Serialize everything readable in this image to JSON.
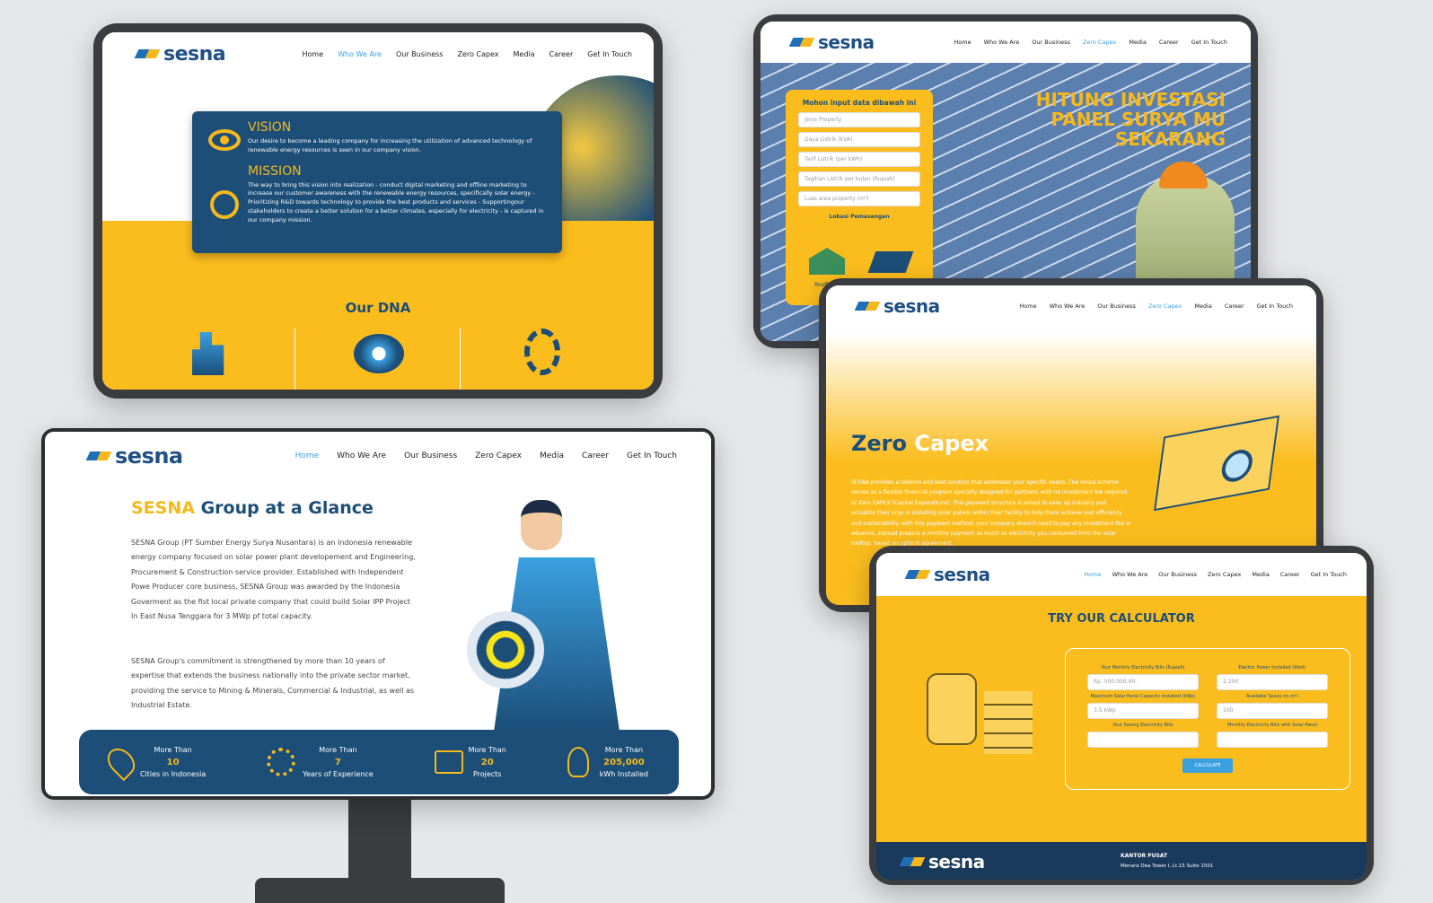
{
  "brand": {
    "name": "sesna",
    "colors": {
      "yellow": "#fbbd1e",
      "navy": "#1c4e78",
      "blue": "#3aa0e0"
    }
  },
  "nav": {
    "items": [
      "Home",
      "Who We Are",
      "Our Business",
      "Zero Capex",
      "Media",
      "Career",
      "Get In Touch"
    ]
  },
  "vision_page": {
    "active": "Who We Are",
    "vision_title": "VISION",
    "vision_text": "Our desire to become a leading company for increasing the utilization of advanced technology of renewable energy resources is seen in our company vision.",
    "mission_title": "MISSION",
    "mission_text": "The way to bring this vision into realization - conduct digital marketing and offline marketing to increase our customer awareness with the renewable energy resources, specifically solar energy - Prioritizing R&D towards technology to provide the best products and services - Supportingour stakeholders to create a better solution for a better climates, especially for electricity - is captured in our company mission.",
    "dna_title": "Our DNA"
  },
  "invest_page": {
    "active": "Zero Capex",
    "form_title": "Mohon input data dibawah ini",
    "fields": [
      "Jenis Property",
      "Daya Listrik (kVA)",
      "Tarif Listrik (per kWh)",
      "Tagihan Listrik per bulan (Rupiah)",
      "Luas area property (m²)"
    ],
    "location_label": "Lokasi Pemasangan",
    "rooftop": "Rooftop",
    "headline": [
      "HITUNG INVESTASI",
      "PANEL SURYA MU",
      "SEKARANG"
    ]
  },
  "capex_page": {
    "active": "Zero Capex",
    "title_a": "Zero",
    "title_b": "Capex",
    "body": "SESNA provides a tailored and best solution that addresses your specific needs. The rental scheme serves as a flexible financial program specially designed for partners, with no investment fee required or Zero CAPEX (Capital Expenditure). This payment structure is aimed to ease up industry and actualize their urge in installing solar panels within their facility to help them achieve cost efficiency and sustainability. with this payment method, your company doesn't need to pay any investment fee in advance, instead prepare a monthly payment as much as electricity you consumed from the solar rooftop, based on upfront agreement."
  },
  "glance_page": {
    "active": "Home",
    "title_a": "SESNA",
    "title_b": "Group at a Glance",
    "p1": "SESNA Group (PT Sumber Energy Surya Nusantara) is an Indonesia renewable energy company focused on solar power plant developement and Engineering, Procurement & Construction service provider. Established with Independent Powe Producer core business, SESNA Group was awarded by the Indonesia Goverment as the fist local private company that could build Solar IPP Project In East Nusa Tenggara for 3 MWp pf total capacity.",
    "p2": "SESNA Group's commitment is strengthened by more than 10 years of expertise that extends the business nationally into the private sector market, providing the service to Mining & Minerals, Commercial & Industrial, as well as Industrial Estate.",
    "stats": [
      {
        "pre": "More Than",
        "num": "10",
        "label": "Cities in Indonesia",
        "icon": "map-pin-icon"
      },
      {
        "pre": "More Than",
        "num": "7",
        "label": "Years of Experience",
        "icon": "gear-icon"
      },
      {
        "pre": "More Than",
        "num": "20",
        "label": "Projects",
        "icon": "briefcase-icon"
      },
      {
        "pre": "More Than",
        "num": "205,000",
        "label": "kWh Installed",
        "icon": "lightbulb-icon"
      }
    ]
  },
  "calc_page": {
    "active": "Home",
    "title": "TRY OUR CALCULATOR",
    "labels": [
      "Your Monthly Electricity Bills (Rupiah)",
      "Electric Power Installed (Watt)",
      "Maximum Solar Panel Capacity Installed (kWp)",
      "Available Space (in m²)",
      "Your Saving Electricity Bills",
      "Monthly Electricity Bills with Solar Panel"
    ],
    "values": [
      "Rp. 500.000,00-",
      "2.200",
      "3.5 kWp",
      "100",
      "",
      ""
    ],
    "button": "CALCULATE",
    "footer_title": "KANTOR PUSAT",
    "footer_addr": "Menara Dea Tower I, Lt.15 Suite 1501"
  }
}
